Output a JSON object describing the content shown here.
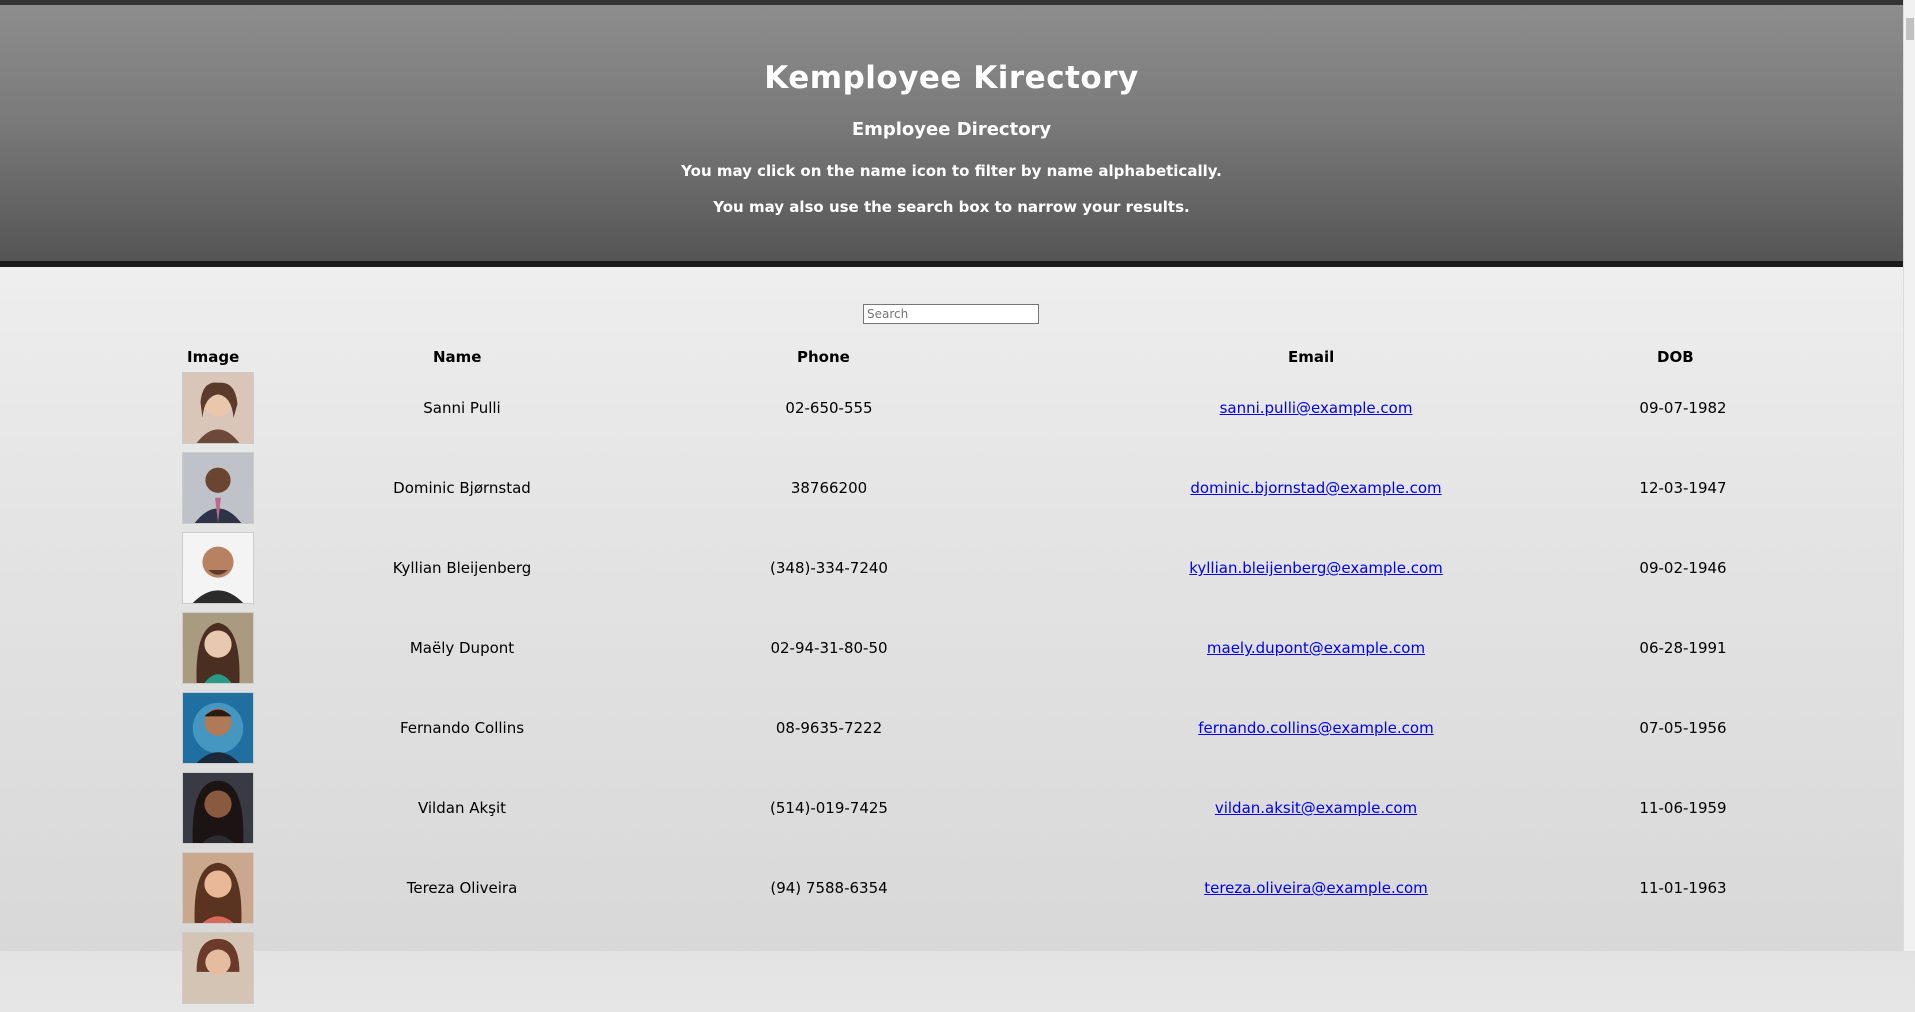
{
  "header": {
    "title": "Kemployee Kirectory",
    "subtitle": "Employee Directory",
    "line1": "You may click on the name icon to filter by name alphabetically.",
    "line2": "You may also use the search box to narrow your results."
  },
  "search": {
    "placeholder": "Search",
    "value": ""
  },
  "table": {
    "columns": [
      "Image",
      "Name",
      "Phone",
      "Email",
      "DOB"
    ],
    "rows": [
      {
        "name": "Sanni Pulli",
        "phone": "02-650-555",
        "email": "sanni.pulli@example.com",
        "dob": "09-07-1982"
      },
      {
        "name": "Dominic Bjørnstad",
        "phone": "38766200",
        "email": "dominic.bjornstad@example.com",
        "dob": "12-03-1947"
      },
      {
        "name": "Kyllian Bleijenberg",
        "phone": "(348)-334-7240",
        "email": "kyllian.bleijenberg@example.com",
        "dob": "09-02-1946"
      },
      {
        "name": "Maëly Dupont",
        "phone": "02-94-31-80-50",
        "email": "maely.dupont@example.com",
        "dob": "06-28-1991"
      },
      {
        "name": "Fernando Collins",
        "phone": "08-9635-7222",
        "email": "fernando.collins@example.com",
        "dob": "07-05-1956"
      },
      {
        "name": "Vildan Akşit",
        "phone": "(514)-019-7425",
        "email": "vildan.aksit@example.com",
        "dob": "11-06-1959"
      },
      {
        "name": "Tereza Oliveira",
        "phone": "(94) 7588-6354",
        "email": "tereza.oliveira@example.com",
        "dob": "11-01-1963"
      }
    ]
  },
  "colors": {
    "link": "#0000ee",
    "header_top": "#8d8d8d",
    "header_bottom": "#555555"
  }
}
